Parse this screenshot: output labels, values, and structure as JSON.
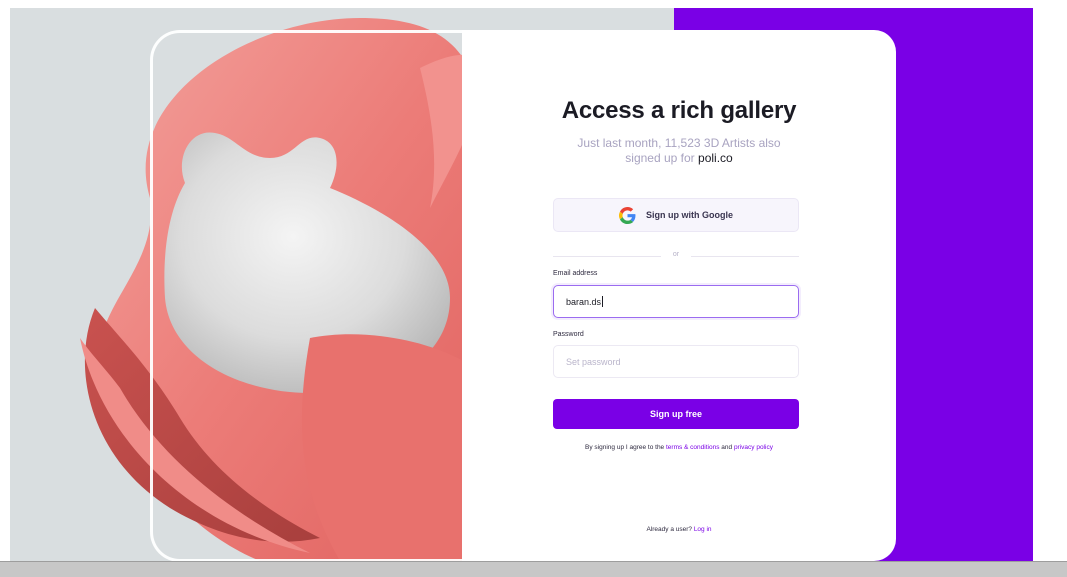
{
  "card": {
    "title": "Access a rich gallery",
    "subtitle_pre": "Just last month, 11,523 3D Artists also signed up for",
    "subtitle_brand": "poli.co"
  },
  "google": {
    "label": "Sign up with Google",
    "icon": "google-icon"
  },
  "divider": {
    "text": "or"
  },
  "form": {
    "email_label": "Email address",
    "email_value": "baran.ds",
    "password_label": "Password",
    "password_placeholder": "Set password",
    "submit_label": "Sign up free"
  },
  "terms": {
    "prefix": "By signing up I agree to the",
    "terms_link": "terms & conditions",
    "conjunction": "and",
    "privacy_link": "privacy policy"
  },
  "login": {
    "prefix": "Already a user?",
    "link": "Log in"
  },
  "colors": {
    "accent": "#7a00e6",
    "background_left": "#d9dee0",
    "art_fabric": "#ee7f7c"
  }
}
